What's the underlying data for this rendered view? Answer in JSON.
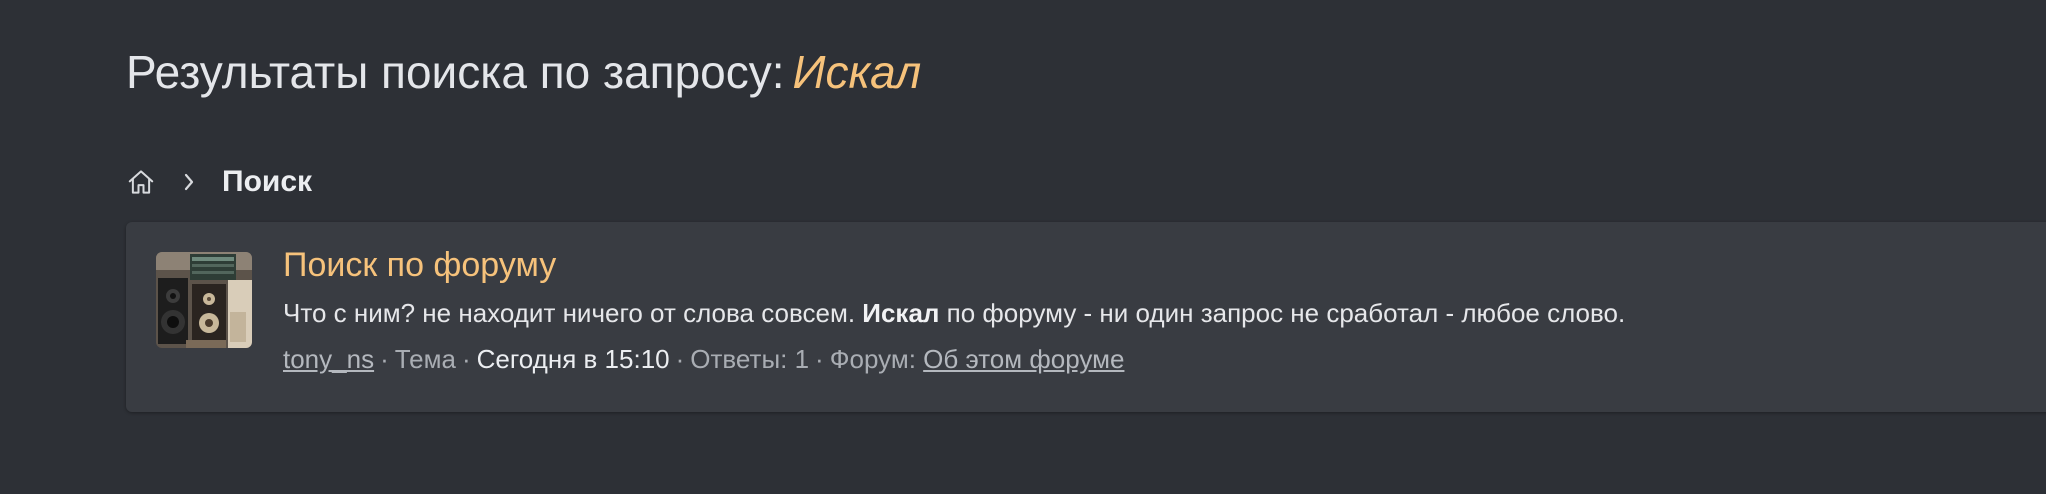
{
  "header": {
    "title_prefix": "Результаты поиска по запросу:",
    "query": "Искал"
  },
  "breadcrumb": {
    "home_icon": "home-icon",
    "separator_icon": "chevron-right-icon",
    "current": "Поиск"
  },
  "results": [
    {
      "title": "Поиск по форуму",
      "snippet_before": "Что с ним? не находит ничего от слова совсем.",
      "snippet_highlight": "Искал",
      "snippet_after": "по форуму - ни один запрос не сработал - любое слово.",
      "author": "tony_ns",
      "type": "Тема",
      "date": "Сегодня в 15:10",
      "replies": "Ответы: 1",
      "forum_label": "Форум:",
      "forum": "Об этом форуме",
      "separator": "·"
    }
  ],
  "colors": {
    "background": "#2d3036",
    "panel": "#393c42",
    "accent": "#f6c27b",
    "text": "#e6e7ea",
    "muted": "#a9adb3"
  }
}
